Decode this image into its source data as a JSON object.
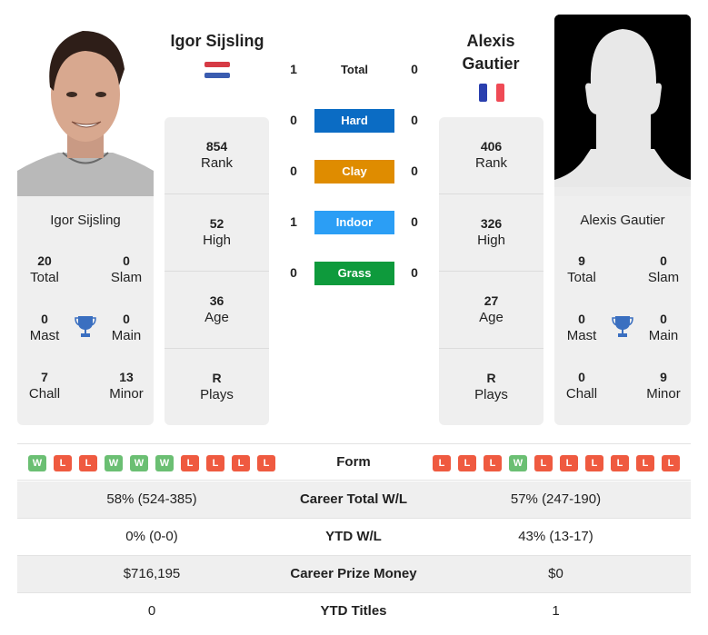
{
  "player1": {
    "name": "Igor Sijsling",
    "country": "Netherlands",
    "flag_colors": [
      "#d63a45",
      "#ffffff",
      "#3a5cb0"
    ],
    "card_name": "Igor Sijsling",
    "titles": {
      "total": {
        "value": "20",
        "label": "Total"
      },
      "slam": {
        "value": "0",
        "label": "Slam"
      },
      "mast": {
        "value": "0",
        "label": "Mast"
      },
      "main": {
        "value": "0",
        "label": "Main"
      },
      "chall": {
        "value": "7",
        "label": "Chall"
      },
      "minor": {
        "value": "13",
        "label": "Minor"
      }
    },
    "rank": {
      "value": "854",
      "label": "Rank"
    },
    "high": {
      "value": "52",
      "label": "High"
    },
    "age": {
      "value": "36",
      "label": "Age"
    },
    "plays": {
      "value": "R",
      "label": "Plays"
    },
    "form": [
      "W",
      "L",
      "L",
      "W",
      "W",
      "W",
      "L",
      "L",
      "L",
      "L"
    ]
  },
  "player2": {
    "name": "Alexis Gautier",
    "country": "France",
    "flag_colors": [
      "#2a3fae",
      "#ffffff",
      "#ef4a55"
    ],
    "card_name": "Alexis Gautier",
    "titles": {
      "total": {
        "value": "9",
        "label": "Total"
      },
      "slam": {
        "value": "0",
        "label": "Slam"
      },
      "mast": {
        "value": "0",
        "label": "Mast"
      },
      "main": {
        "value": "0",
        "label": "Main"
      },
      "chall": {
        "value": "0",
        "label": "Chall"
      },
      "minor": {
        "value": "9",
        "label": "Minor"
      }
    },
    "rank": {
      "value": "406",
      "label": "Rank"
    },
    "high": {
      "value": "326",
      "label": "High"
    },
    "age": {
      "value": "27",
      "label": "Age"
    },
    "plays": {
      "value": "R",
      "label": "Plays"
    },
    "form": [
      "L",
      "L",
      "L",
      "W",
      "L",
      "L",
      "L",
      "L",
      "L",
      "L"
    ]
  },
  "h2h": [
    {
      "label": "Total",
      "p1": "1",
      "p2": "0",
      "color": ""
    },
    {
      "label": "Hard",
      "p1": "0",
      "p2": "0",
      "color": "#0b6cc4"
    },
    {
      "label": "Clay",
      "p1": "0",
      "p2": "0",
      "color": "#df8c00"
    },
    {
      "label": "Indoor",
      "p1": "1",
      "p2": "0",
      "color": "#2b9ef5"
    },
    {
      "label": "Grass",
      "p1": "0",
      "p2": "0",
      "color": "#0e9a3c"
    }
  ],
  "form_label": "Form",
  "stats": [
    {
      "label": "Career Total W/L",
      "p1": "58% (524-385)",
      "p2": "57% (247-190)"
    },
    {
      "label": "YTD W/L",
      "p1": "0% (0-0)",
      "p2": "43% (13-17)"
    },
    {
      "label": "Career Prize Money",
      "p1": "$716,195",
      "p2": "$0"
    },
    {
      "label": "YTD Titles",
      "p1": "0",
      "p2": "1"
    }
  ],
  "icons": {
    "trophy": "trophy-icon",
    "placeholder": "avatar-silhouette"
  },
  "colors": {
    "win": "#6bbf73",
    "loss": "#ef5a40",
    "trophy": "#3a6fc0",
    "panel": "#efefef"
  }
}
